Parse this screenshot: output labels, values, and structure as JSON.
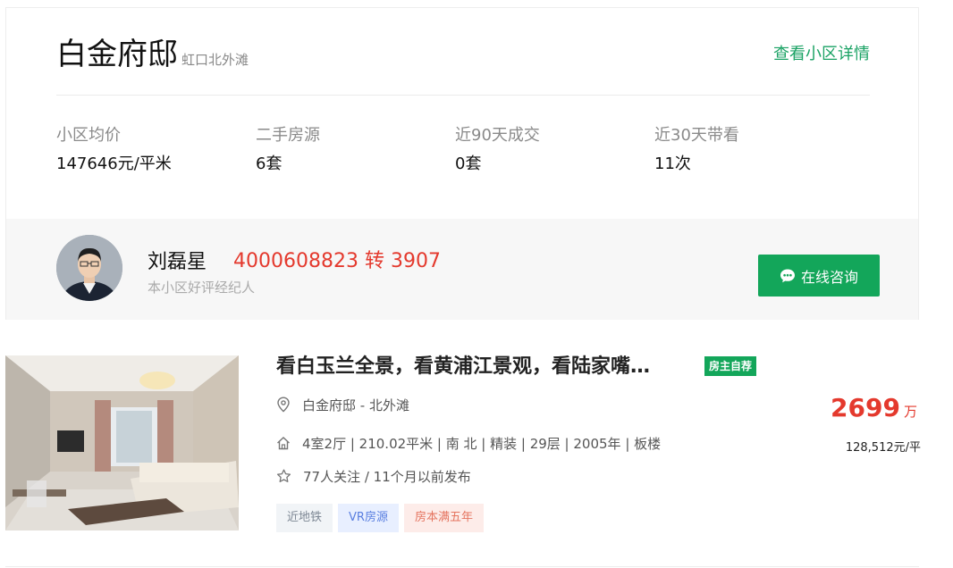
{
  "community": {
    "name": "白金府邸",
    "location": "虹口北外滩",
    "detail_link": "查看小区详情",
    "stats": [
      {
        "label": "小区均价",
        "value": "147646元/平米"
      },
      {
        "label": "二手房源",
        "value": "6套"
      },
      {
        "label": "近90天成交",
        "value": "0套"
      },
      {
        "label": "近30天带看",
        "value": "11次"
      }
    ]
  },
  "agent": {
    "name": "刘磊星",
    "phone": "4000608823 转 3907",
    "tag": "本小区好评经纪人",
    "consult_label": "在线咨询",
    "consult_icon": "chat-bubble-icon"
  },
  "listing": {
    "title": "看白玉兰全景，看黄浦江景观，看陆家嘴…",
    "badge": "房主自荐",
    "location": "白金府邸 - 北外滩",
    "house_info": "4室2厅 | 210.02平米 | 南 北 | 精装 | 29层 | 2005年 | 板楼",
    "follow_info": "77人关注 / 11个月以前发布",
    "tags": [
      "近地铁",
      "VR房源",
      "房本满五年"
    ],
    "total_price": "2699",
    "price_unit": "万",
    "unit_price": "128,512元/平"
  },
  "colors": {
    "brand_green": "#13a65a",
    "price_red": "#e4392d",
    "link_green": "#1aa264"
  }
}
